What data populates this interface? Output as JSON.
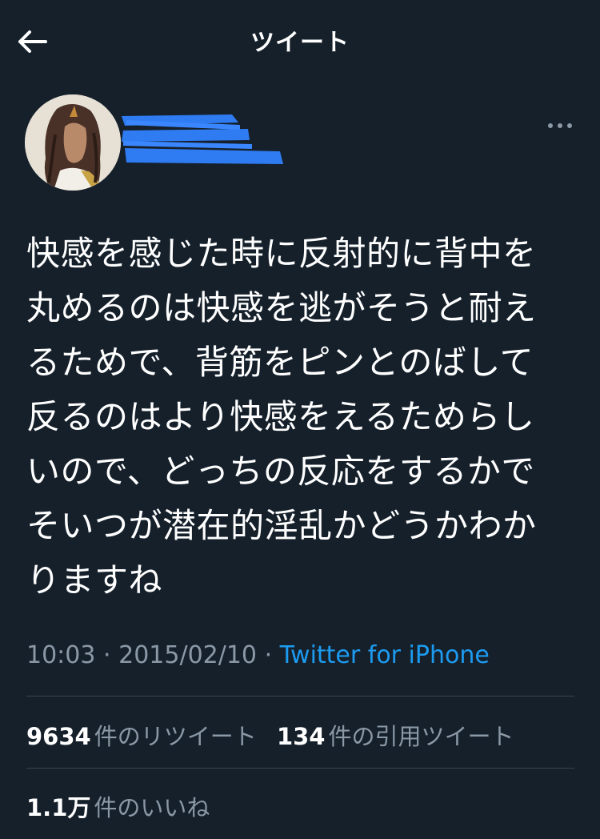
{
  "header": {
    "title": "ツイート",
    "back_icon": "arrow-left-icon"
  },
  "author": {
    "avatar_icon": "avatar-image",
    "name_redacted": true,
    "redaction_color": "#2f7bf1"
  },
  "more_icon": "more-horizontal-icon",
  "tweet": {
    "text": "快感を感じた時に反射的に背中を\n丸めるのは快感を逃がそうと耐え\nるためで、背筋をピンとのばして\n反るのはより快感をえるためらし\nいので、どっちの反応をするかで\nそいつが潜在的淫乱かどうかわか\nりますね"
  },
  "meta": {
    "time": "10:03",
    "separator": "·",
    "date": "2015/02/10",
    "source": "Twitter for iPhone"
  },
  "stats": {
    "retweets_count": "9634",
    "retweets_label": "件のリツイート",
    "quotes_count": "134",
    "quotes_label": "件の引用ツイート",
    "likes_count": "1.1万",
    "likes_label": "件のいいね"
  },
  "colors": {
    "background": "#15202b",
    "text": "#ffffff",
    "secondary": "#8b98a5",
    "link": "#1d9bf0",
    "divider": "#38444d"
  }
}
